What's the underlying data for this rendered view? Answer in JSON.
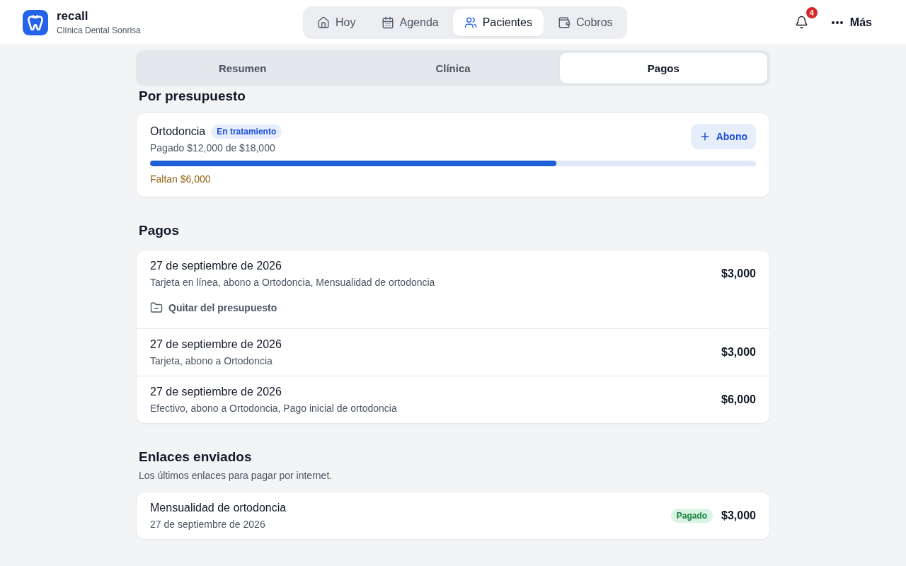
{
  "app": {
    "name": "recall",
    "subtitle": "Clínica Dental Sonrisa"
  },
  "nav": [
    {
      "label": "Hoy",
      "selected": false
    },
    {
      "label": "Agenda",
      "selected": false
    },
    {
      "label": "Pacientes",
      "selected": true
    },
    {
      "label": "Cobros",
      "selected": false
    }
  ],
  "notifications": {
    "count": "4"
  },
  "more": {
    "label": "Más"
  },
  "tabs": [
    {
      "label": "Resumen",
      "selected": false
    },
    {
      "label": "Clínica",
      "selected": false
    },
    {
      "label": "Pagos",
      "selected": true
    }
  ],
  "budget_section": {
    "title": "Por presupuesto",
    "items": [
      {
        "name": "Ortodoncia",
        "status": "En tratamiento",
        "paid": "Pagado $12,000 de $18,000",
        "level": 0.67,
        "remaining": "Faltan $6,000",
        "action": "Abono"
      }
    ]
  },
  "payments_section": {
    "title": "Pagos",
    "items": [
      {
        "date": "27 de septiembre de 2026",
        "detail": "Tarjeta en línea, abono a Ortodoncia, Mensualidad de ortodoncia",
        "amount": "$3,000",
        "action": "Quitar del presupuesto"
      },
      {
        "date": "27 de septiembre de 2026",
        "detail": "Tarjeta, abono a Ortodoncia",
        "amount": "$3,000"
      },
      {
        "date": "27 de septiembre de 2026",
        "detail": "Efectivo, abono a Ortodoncia, Pago inicial de ortodoncia",
        "amount": "$6,000"
      }
    ]
  },
  "links_section": {
    "title": "Enlaces enviados",
    "subtitle": "Los últimos enlaces para pagar por internet.",
    "items": [
      {
        "title": "Mensualidad de ortodoncia",
        "date": "27 de septiembre de 2026",
        "status": "Pagado",
        "amount": "$3,000"
      }
    ]
  }
}
